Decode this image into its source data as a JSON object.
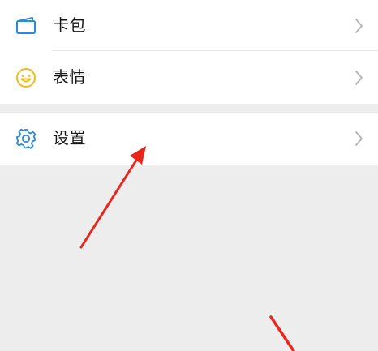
{
  "menu": {
    "items": [
      {
        "label": "卡包",
        "icon": "card-wallet-icon"
      },
      {
        "label": "表情",
        "icon": "smiley-icon"
      },
      {
        "label": "设置",
        "icon": "gear-icon"
      }
    ]
  },
  "colors": {
    "page_background": "#ededed",
    "row_background": "#ffffff",
    "text": "#161616",
    "chevron": "#b2b2b2",
    "card_icon": "#2a8bd6",
    "smiley_icon": "#f2b91f",
    "gear_icon": "#2a8bd6",
    "annotation_arrow": "#e8261c"
  }
}
